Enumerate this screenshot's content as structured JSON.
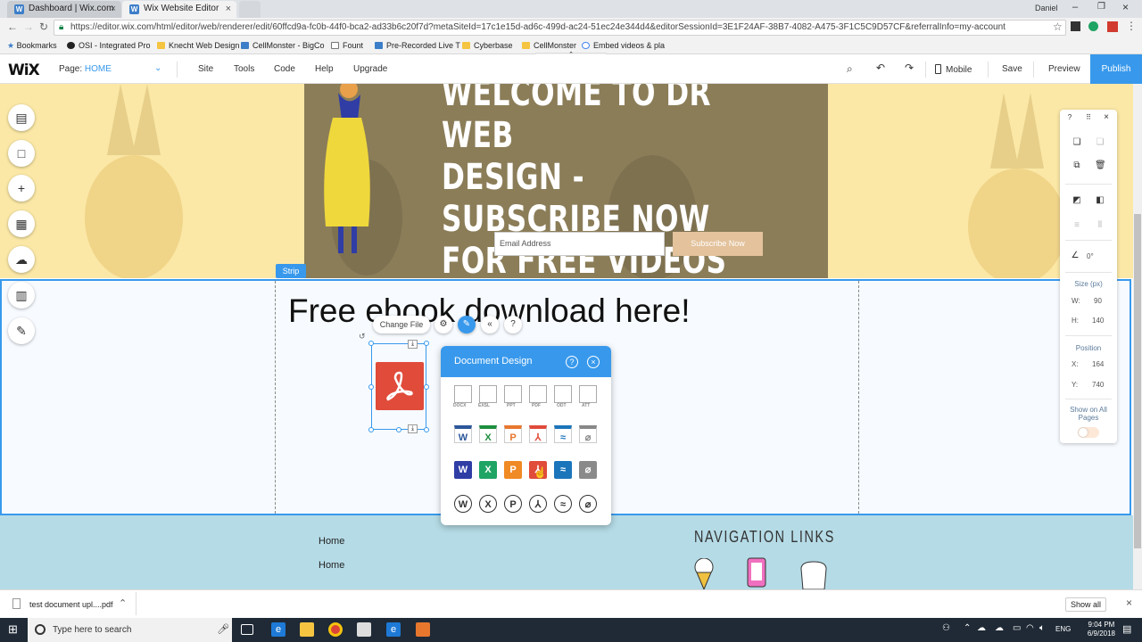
{
  "browser": {
    "tabs": [
      {
        "title": "Dashboard | Wix.com",
        "close": "×"
      },
      {
        "title": "Wix Website Editor",
        "close": "×"
      }
    ],
    "user_name": "Daniel",
    "url": "https://editor.wix.com/html/editor/web/renderer/edit/60ffcd9a-fc0b-44f0-bca2-ad33b6c20f7d?metaSiteId=17c1e15d-ad6c-499d-ac24-51ec24e344d4&editorSessionId=3E1F24AF-38B7-4082-A475-3F1C5C9D57CF&referralInfo=my-account",
    "bookmarks": [
      "Bookmarks",
      "OSI - Integrated Pro",
      "Knecht Web Design",
      "CellMonster - BigCo",
      "Fount",
      "Pre-Recorded Live T",
      "Cyberbase",
      "CellMonster",
      "Embed videos & pla"
    ]
  },
  "editor": {
    "logo": "WiX",
    "page_label": "Page:",
    "page_name": "HOME",
    "menu": [
      "Site",
      "Tools",
      "Code",
      "Help",
      "Upgrade"
    ],
    "mobile": "Mobile",
    "save": "Save",
    "preview": "Preview",
    "publish": "Publish"
  },
  "site": {
    "hero_title": "WELCOME TO DR WEB\nDESIGN - SUBSCRIBE NOW\nFOR FREE VIDEOS",
    "email_placeholder": "Email Address",
    "subscribe": "Subscribe Now",
    "strip_label": "Strip",
    "ebook_heading": "Free ebook download here!",
    "footer_links": [
      "Home",
      "Home"
    ],
    "nav_heading": "NAVIGATION LINKS"
  },
  "toolbar": {
    "change_file": "Change File",
    "help": "?"
  },
  "doc_panel": {
    "title": "Document Design",
    "help": "?",
    "close": "×",
    "row1_labels": [
      "DOCX",
      "EXSL",
      "PPT",
      "PDF",
      "ODT",
      "ATT"
    ],
    "row3_letters": [
      "W",
      "X",
      "P",
      "",
      "",
      ""
    ],
    "row4_letters": [
      "W",
      "X",
      "P",
      "",
      "",
      ""
    ]
  },
  "right_panel": {
    "help": "?",
    "close": "×",
    "angle": "0°",
    "size_label": "Size (px)",
    "w_label": "W:",
    "w_value": "90",
    "h_label": "H:",
    "h_value": "140",
    "position_label": "Position",
    "x_label": "X:",
    "x_value": "164",
    "y_label": "Y:",
    "y_value": "740",
    "show_all_pages": "Show on All Pages"
  },
  "downloads": {
    "file": "test document upl....pdf",
    "show_all": "Show all"
  },
  "taskbar": {
    "search_placeholder": "Type here to search",
    "lang": "ENG",
    "time": "9:04 PM",
    "date": "6/9/2018"
  }
}
